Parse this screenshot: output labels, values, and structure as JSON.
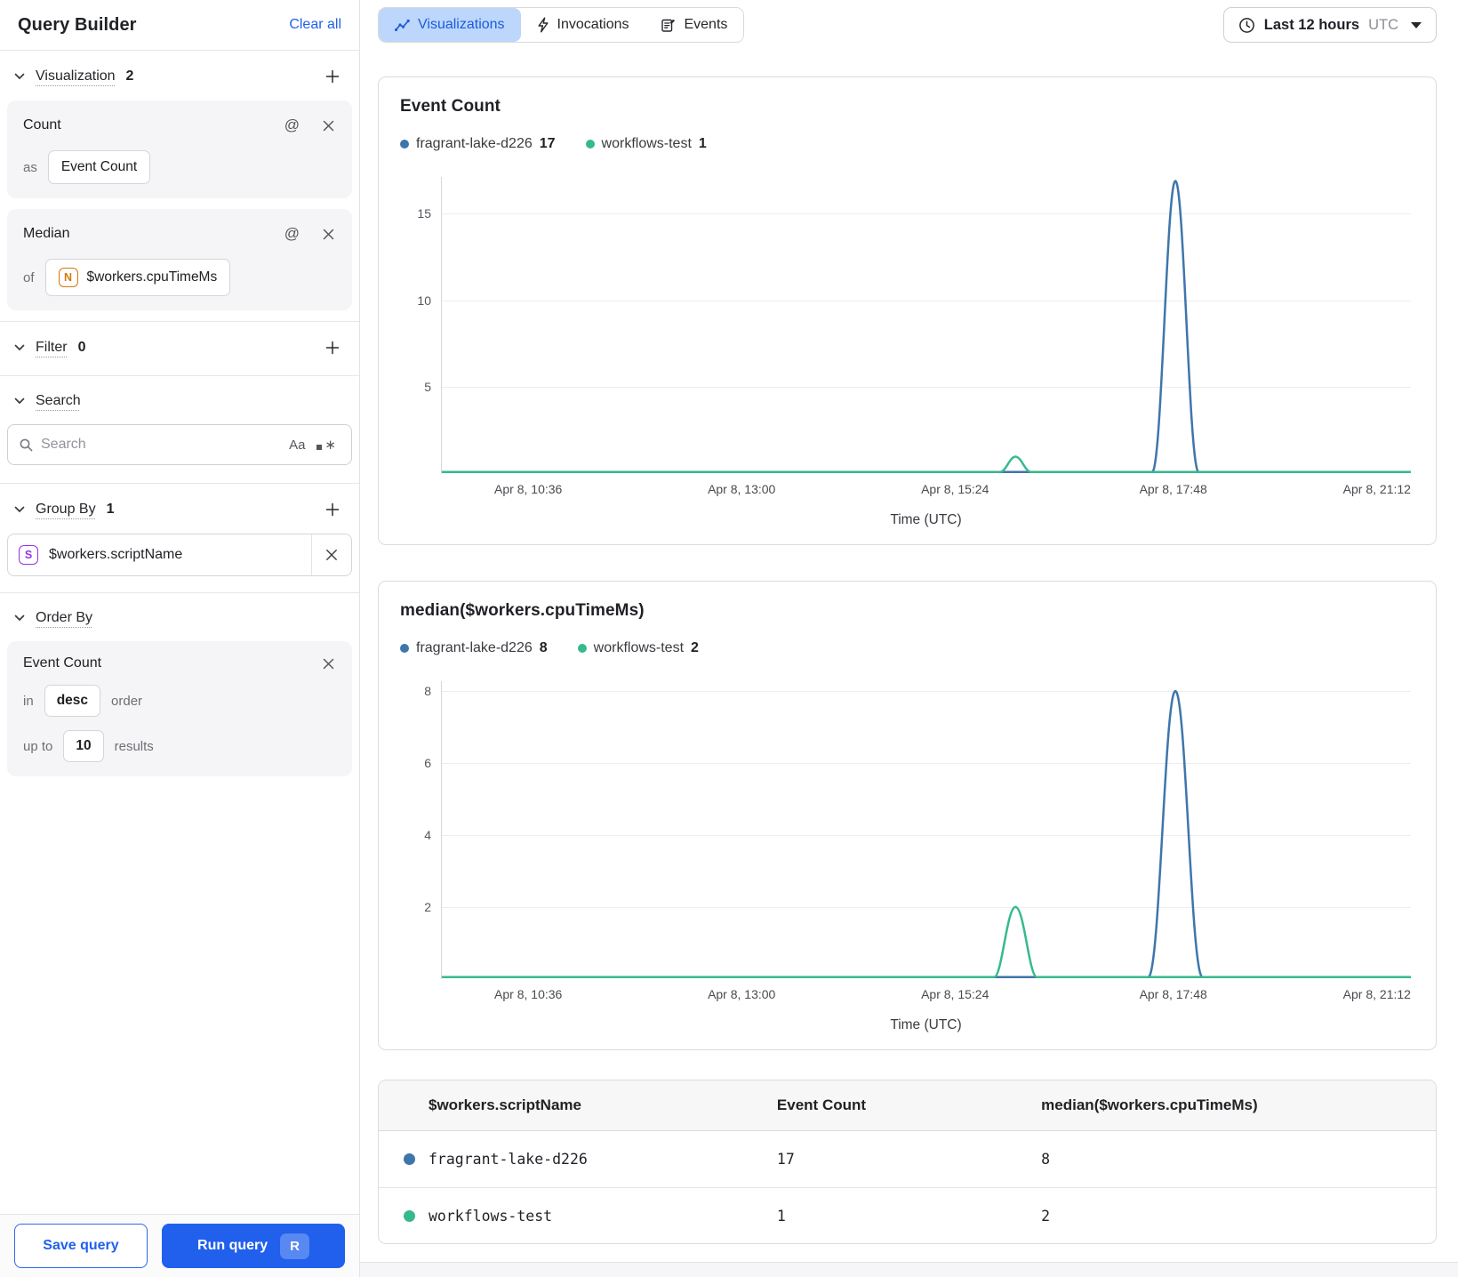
{
  "icons": {
    "plus": "+",
    "at": "@",
    "close": "✕",
    "case_sensitivity": "Aa",
    "regex_star": "∗"
  },
  "sidebar": {
    "title": "Query Builder",
    "clear_all": "Clear all",
    "visualization_section": {
      "label": "Visualization",
      "count": "2"
    },
    "visualization_cards": [
      {
        "title": "Count",
        "prefix": "as",
        "value": "Event Count"
      },
      {
        "title": "Median",
        "prefix": "of",
        "type_badge": "N",
        "value": "$workers.cpuTimeMs"
      }
    ],
    "filter_section": {
      "label": "Filter",
      "count": "0"
    },
    "search_section": {
      "label": "Search",
      "placeholder": "Search"
    },
    "group_by_section": {
      "label": "Group By",
      "count": "1",
      "item": {
        "type_badge": "S",
        "value": "$workers.scriptName"
      }
    },
    "order_by_section": {
      "label": "Order By",
      "field": "Event Count",
      "in_label": "in",
      "direction": "desc",
      "order_label": "order",
      "upto_label": "up to",
      "limit": "10",
      "results_label": "results"
    },
    "footer": {
      "save": "Save query",
      "run": "Run query",
      "run_shortcut": "R"
    }
  },
  "header": {
    "tabs": [
      {
        "label": "Visualizations",
        "icon": "line-chart-icon",
        "active": true
      },
      {
        "label": "Invocations",
        "icon": "lightning-icon",
        "active": false
      },
      {
        "label": "Events",
        "icon": "events-form-icon",
        "active": false
      }
    ],
    "time_picker": {
      "label": "Last 12 hours",
      "timezone": "UTC"
    }
  },
  "colors": {
    "accent_blue": "#2160ed",
    "active_tab_bg": "#bcd7fb",
    "active_tab_text": "#1d5bdb",
    "series_blue": "#3e76ab",
    "series_green": "#36ba8c",
    "badge_number_orange": "#d97708",
    "badge_string_purple": "#9333ea"
  },
  "chart_data": [
    {
      "type": "line",
      "title": "Event Count",
      "xlabel": "Time (UTC)",
      "x_ticks": [
        "Apr 8, 10:36",
        "Apr 8, 13:00",
        "Apr 8, 15:24",
        "Apr 8, 17:48",
        "Apr 8, 21:12"
      ],
      "y_ticks": [
        15,
        10,
        5
      ],
      "ylim": [
        0,
        17.1
      ],
      "grid": true,
      "legend_position": "top-left",
      "series": [
        {
          "name": "fragrant-lake-d226",
          "color": "#3e76ab",
          "total": 17,
          "shape": "flat at 0 with a single narrow spike",
          "peak": {
            "time": "Apr 8, ~17:45",
            "value": 17
          }
        },
        {
          "name": "workflows-test",
          "color": "#36ba8c",
          "total": 1,
          "shape": "flat at 0 with a single small bump",
          "peak": {
            "time": "Apr 8, ~15:50",
            "value": 1
          }
        }
      ]
    },
    {
      "type": "line",
      "title": "median($workers.cpuTimeMs)",
      "xlabel": "Time (UTC)",
      "x_ticks": [
        "Apr 8, 10:36",
        "Apr 8, 13:00",
        "Apr 8, 15:24",
        "Apr 8, 17:48",
        "Apr 8, 21:12"
      ],
      "y_ticks": [
        8,
        6,
        4,
        2
      ],
      "ylim": [
        0,
        8.3
      ],
      "grid": true,
      "legend_position": "top-left",
      "series": [
        {
          "name": "fragrant-lake-d226",
          "color": "#3e76ab",
          "total": 8,
          "shape": "flat at 0 with a single narrow spike",
          "peak": {
            "time": "Apr 8, ~17:45",
            "value": 8
          }
        },
        {
          "name": "workflows-test",
          "color": "#36ba8c",
          "total": 2,
          "shape": "flat at 0 with a single small bump",
          "peak": {
            "time": "Apr 8, ~15:50",
            "value": 2
          }
        }
      ]
    },
    {
      "type": "table",
      "columns": [
        "$workers.scriptName",
        "Event Count",
        "median($workers.cpuTimeMs)"
      ],
      "rows": [
        {
          "script_name": "fragrant-lake-d226",
          "dot_color": "#3e76ab",
          "event_count": 17,
          "median_cpu": 8
        },
        {
          "script_name": "workflows-test",
          "dot_color": "#36ba8c",
          "event_count": 1,
          "median_cpu": 2
        }
      ]
    }
  ]
}
